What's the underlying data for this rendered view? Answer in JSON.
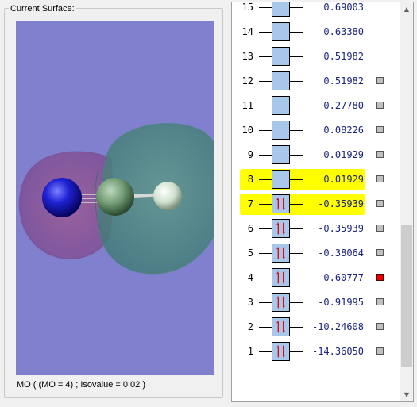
{
  "surface_group": {
    "label": "Current Surface:"
  },
  "status_text": "MO ( (MO = 4) ; Isovalue = 0.02 )",
  "colors": {
    "viewport_bg": "#8080cf",
    "highlight": "#ffff00",
    "orbital_box": "#a9c7ea",
    "energy_text": "#1a237e",
    "selected_marker": "#e60000",
    "electron_arrow": "#e00000"
  },
  "orbitals": [
    {
      "number": "15",
      "energy": "0.69003",
      "occupied": false,
      "highlighted": false,
      "marker": "none",
      "partial": true
    },
    {
      "number": "14",
      "energy": "0.63380",
      "occupied": false,
      "highlighted": false,
      "marker": "none"
    },
    {
      "number": "13",
      "energy": "0.51982",
      "occupied": false,
      "highlighted": false,
      "marker": "none"
    },
    {
      "number": "12",
      "energy": "0.51982",
      "occupied": false,
      "highlighted": false,
      "marker": "gray"
    },
    {
      "number": "11",
      "energy": "0.27780",
      "occupied": false,
      "highlighted": false,
      "marker": "gray"
    },
    {
      "number": "10",
      "energy": "0.08226",
      "occupied": false,
      "highlighted": false,
      "marker": "gray"
    },
    {
      "number": "9",
      "energy": "0.01929",
      "occupied": false,
      "highlighted": false,
      "marker": "gray"
    },
    {
      "number": "8",
      "energy": "0.01929",
      "occupied": false,
      "highlighted": true,
      "marker": "gray"
    },
    {
      "number": "7",
      "energy": "-0.35939",
      "occupied": true,
      "highlighted": true,
      "marker": "gray"
    },
    {
      "number": "6",
      "energy": "-0.35939",
      "occupied": true,
      "highlighted": false,
      "marker": "gray"
    },
    {
      "number": "5",
      "energy": "-0.38064",
      "occupied": true,
      "highlighted": false,
      "marker": "gray"
    },
    {
      "number": "4",
      "energy": "-0.60777",
      "occupied": true,
      "highlighted": false,
      "marker": "red"
    },
    {
      "number": "3",
      "energy": "-0.91995",
      "occupied": true,
      "highlighted": false,
      "marker": "gray"
    },
    {
      "number": "2",
      "energy": "-10.24608",
      "occupied": true,
      "highlighted": false,
      "marker": "gray"
    },
    {
      "number": "1",
      "energy": "-14.36050",
      "occupied": true,
      "highlighted": false,
      "marker": "gray"
    }
  ],
  "scrollbar": {
    "thumb_start": 0.56,
    "thumb_end": 0.94
  }
}
